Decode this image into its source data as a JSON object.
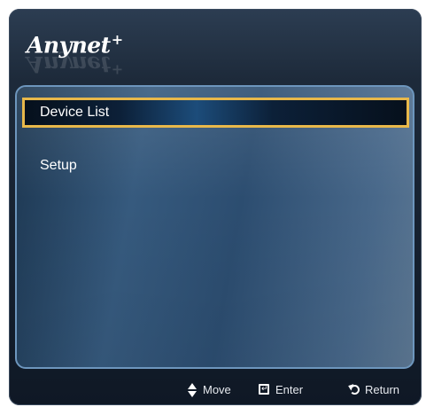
{
  "logo": {
    "text": "Anynet",
    "superscript": "+"
  },
  "menu": {
    "items": [
      {
        "label": "Device List",
        "selected": true
      },
      {
        "label": "Setup",
        "selected": false
      }
    ]
  },
  "footer": {
    "hints": [
      {
        "icon": "up-down-arrows-icon",
        "label": "Move"
      },
      {
        "icon": "enter-icon",
        "label": "Enter"
      },
      {
        "icon": "return-icon",
        "label": "Return"
      }
    ]
  },
  "colors": {
    "selection_border": "#e8b84a",
    "panel_border": "#6d96bd",
    "text": "#ffffff"
  }
}
